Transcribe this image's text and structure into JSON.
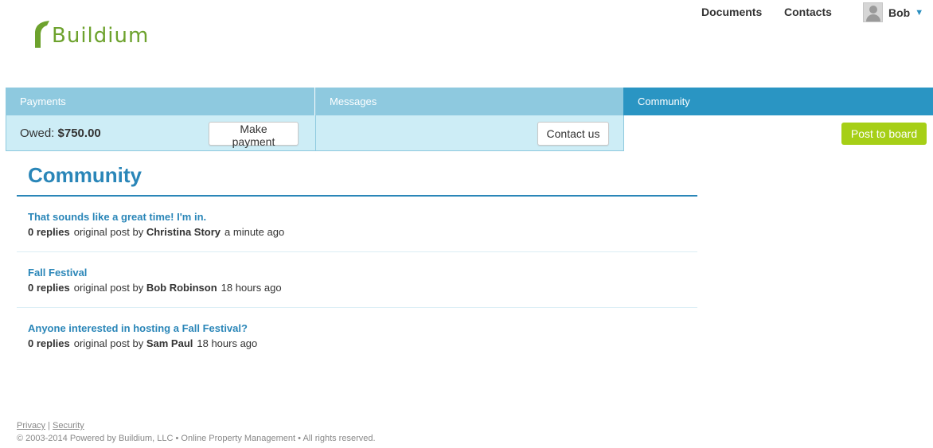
{
  "topnav": {
    "documents": "Documents",
    "contacts": "Contacts",
    "user_name": "Bob",
    "caret": "▼"
  },
  "logo": {
    "text": "Buildium",
    "icon": "buildium-logo-icon"
  },
  "tabs": [
    {
      "label": "Payments"
    },
    {
      "label": "Messages"
    },
    {
      "label": "Community"
    }
  ],
  "payments": {
    "owed_label": "Owed:",
    "owed_amount": "$750.00",
    "make_payment": "Make payment"
  },
  "messages": {
    "contact_us": "Contact us"
  },
  "community": {
    "post_button": "Post to board",
    "title": "Community",
    "posts": [
      {
        "title": "That sounds like a great time! I'm in.",
        "replies": "0 replies",
        "by_label": "original post by",
        "author": "Christina Story",
        "time": "a minute ago"
      },
      {
        "title": "Fall Festival",
        "replies": "0 replies",
        "by_label": "original post by",
        "author": "Bob Robinson",
        "time": "18 hours ago"
      },
      {
        "title": "Anyone interested in hosting a Fall Festival?",
        "replies": "0 replies",
        "by_label": "original post by",
        "author": "Sam Paul",
        "time": "18 hours ago"
      }
    ]
  },
  "footer": {
    "privacy": "Privacy",
    "separator": "|",
    "security": "Security",
    "copyright": "© 2003-2014 Powered by Buildium, LLC • Online Property Management • All rights reserved."
  },
  "colors": {
    "brand_green": "#6da22d",
    "accent_blue": "#2a86b8",
    "tab_light": "#8ec9df",
    "tab_active": "#2a95c3",
    "post_button": "#a6cf16"
  }
}
